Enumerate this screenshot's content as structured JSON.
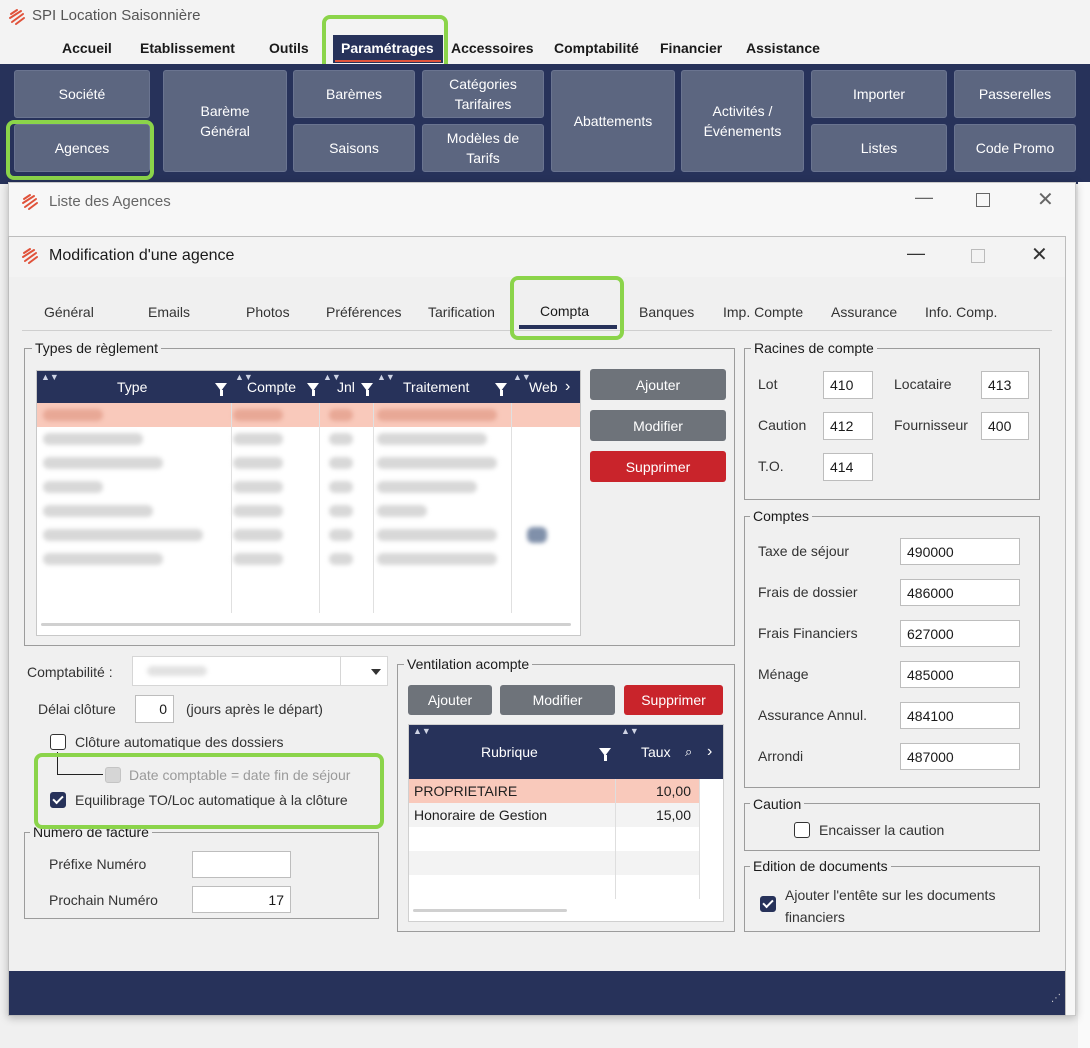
{
  "app": {
    "title": "SPI Location Saisonnière"
  },
  "menu": {
    "items": [
      "Accueil",
      "Etablissement",
      "Outils",
      "Paramétrages",
      "Accessoires",
      "Comptabilité",
      "Financier",
      "Assistance"
    ]
  },
  "ribbon": {
    "societe": "Société",
    "agences": "Agences",
    "bareme_general": "Barème\nGénéral",
    "baremes": "Barèmes",
    "saisons": "Saisons",
    "categories_tarifaires": "Catégories\nTarifaires",
    "modeles_tarifs": "Modèles de\nTarifs",
    "abattements": "Abattements",
    "activites": "Activités /\nÉvénements",
    "importer": "Importer",
    "listes": "Listes",
    "passerelles": "Passerelles",
    "code_promo": "Code Promo"
  },
  "window_liste": {
    "title": "Liste des Agences"
  },
  "window_modif": {
    "title": "Modification d'une agence"
  },
  "tabs": [
    "Général",
    "Emails",
    "Photos",
    "Préférences",
    "Tarification",
    "Compta",
    "Banques",
    "Imp. Compte",
    "Assurance",
    "Info. Comp."
  ],
  "types_reglement": {
    "label": "Types de règlement",
    "columns": [
      "Type",
      "Compte",
      "Jnl",
      "Traitement",
      "Web"
    ],
    "buttons": {
      "add": "Ajouter",
      "edit": "Modifier",
      "delete": "Supprimer"
    }
  },
  "racines": {
    "label": "Racines de compte",
    "lot_label": "Lot",
    "lot_value": "410",
    "locataire_label": "Locataire",
    "locataire_value": "413",
    "caution_label": "Caution",
    "caution_value": "412",
    "fournisseur_label": "Fournisseur",
    "fournisseur_value": "400",
    "to_label": "T.O.",
    "to_value": "414"
  },
  "comptes": {
    "label": "Comptes",
    "rows": [
      {
        "label": "Taxe de séjour",
        "value": "490000"
      },
      {
        "label": "Frais de dossier",
        "value": "486000"
      },
      {
        "label": "Frais Financiers",
        "value": "627000"
      },
      {
        "label": "Ménage",
        "value": "485000"
      },
      {
        "label": "Assurance Annul.",
        "value": "484100"
      },
      {
        "label": "Arrondi",
        "value": "487000"
      }
    ]
  },
  "caution": {
    "label": "Caution",
    "checkbox_label": "Encaisser la caution"
  },
  "edition": {
    "label": "Edition de documents",
    "checkbox_label": "Ajouter l'entête sur les documents financiers"
  },
  "compta": {
    "label": "Comptabilité :",
    "delai_label": "Délai clôture",
    "delai_value": "0",
    "delai_suffix": "(jours après le départ)",
    "cloture_auto": "Clôture automatique des dossiers",
    "date_comptable": "Date comptable = date fin de séjour",
    "equilibrage": "Equilibrage TO/Loc automatique à la clôture"
  },
  "facture": {
    "label": "Numéro de facture",
    "prefixe_label": "Préfixe Numéro",
    "prefixe_value": "",
    "prochain_label": "Prochain Numéro",
    "prochain_value": "17"
  },
  "ventilation": {
    "label": "Ventilation acompte",
    "buttons": {
      "add": "Ajouter",
      "edit": "Modifier",
      "delete": "Supprimer"
    },
    "columns": [
      "Rubrique",
      "Taux"
    ],
    "rows": [
      {
        "rubrique": "PROPRIETAIRE",
        "taux": "10,00"
      },
      {
        "rubrique": "Honoraire de Gestion",
        "taux": "15,00"
      }
    ]
  },
  "colors": {
    "navy": "#27325a",
    "ribbon_button": "#5c6680",
    "highlight": "#8bd44a",
    "danger": "#c9242b",
    "selected_row": "#f9c9bb"
  }
}
